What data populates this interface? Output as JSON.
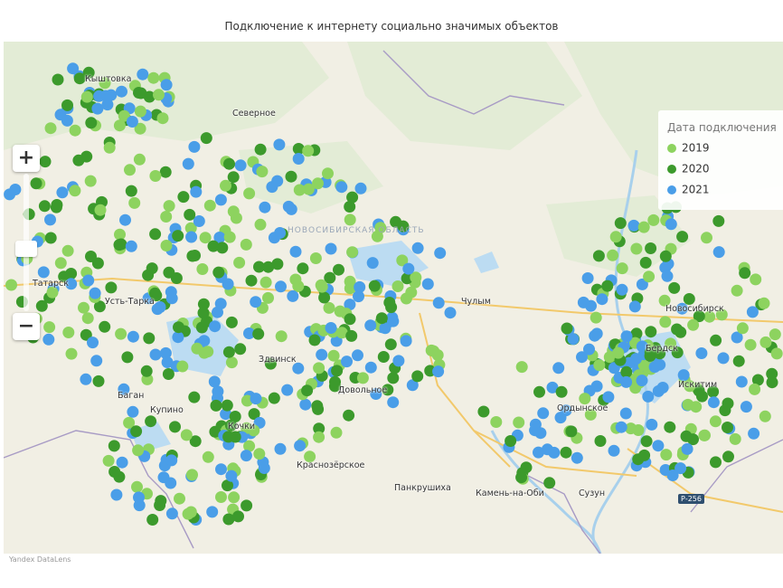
{
  "chart": {
    "title": "Подключение к интернету социально значимых объектов"
  },
  "legend": {
    "title": "Дата подключения",
    "items": [
      {
        "label": "2019",
        "color": "#8dd35f"
      },
      {
        "label": "2020",
        "color": "#3c9a2c"
      },
      {
        "label": "2021",
        "color": "#4a9ee8"
      }
    ]
  },
  "map": {
    "zoom_in_label": "+",
    "zoom_out_label": "−",
    "region_label": "НОВОСИБИРСКАЯ ОБЛАСТЬ",
    "labels": [
      "Северное",
      "Татарск",
      "Чулым",
      "Здвинск",
      "Довольное",
      "Краснозёрское",
      "Купино",
      "Панкрушиха",
      "Камень-на-Оби",
      "Сузун",
      "Бердск",
      "Ордынское",
      "Баган",
      "Усть-Тарка",
      "Кочки",
      "Кыштовка",
      "Искитим",
      "Новосибирск"
    ],
    "road_label": "Р-256",
    "attribution": "Yandex DataLens"
  }
}
